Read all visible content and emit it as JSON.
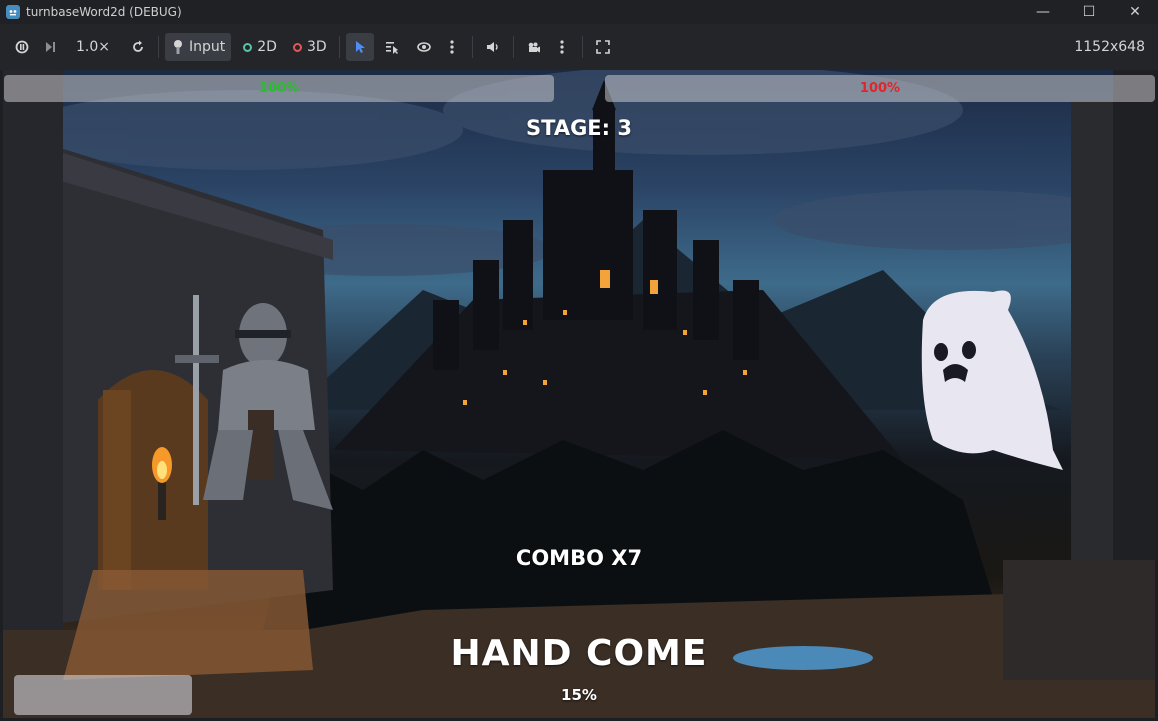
{
  "window": {
    "title": "turnbaseWord2d (DEBUG)",
    "controls": {
      "minimize": "—",
      "maximize": "☐",
      "close": "✕"
    }
  },
  "toolbar": {
    "speed": "1.0×",
    "input_label": "Input",
    "mode_2d": "2D",
    "mode_3d": "3D",
    "resolution": "1152x648"
  },
  "game": {
    "player_hp": {
      "label": "100%",
      "value": 1.0,
      "color": "#27c02d"
    },
    "enemy_hp": {
      "label": "100%",
      "value": 1.0,
      "color": "#e0262a"
    },
    "stage": "STAGE: 3",
    "combo": "COMBO X7",
    "word": "HAND COME",
    "progress": "15%"
  },
  "colors": {
    "mode_2d_ring": "#59c3ae",
    "mode_3d_ring": "#e05959",
    "select_tool": "#4f8ef7"
  }
}
